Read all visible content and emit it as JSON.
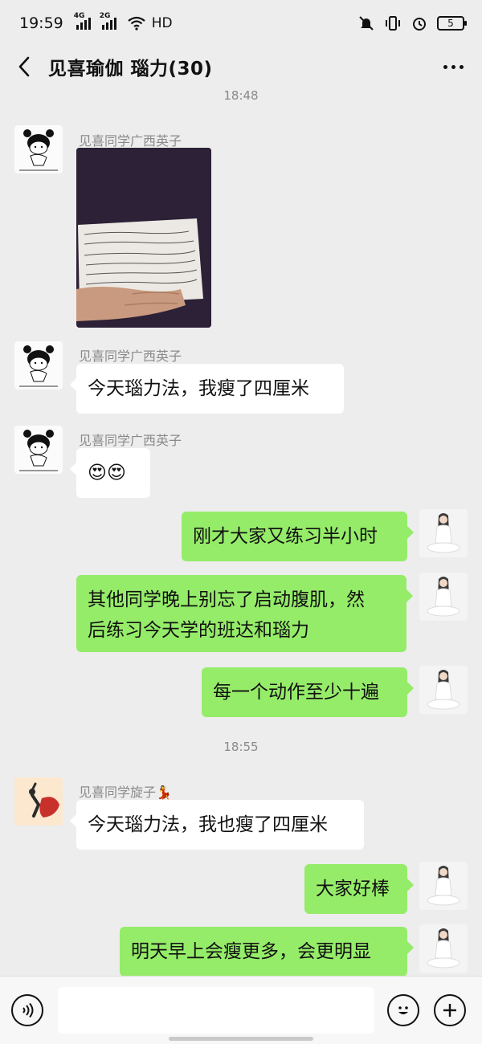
{
  "status_bar": {
    "time": "19:59",
    "network_1": "4G",
    "network_2": "2G",
    "wifi_label": "HD",
    "battery": "5"
  },
  "header": {
    "title": "见喜瑜伽 瑙力(30)"
  },
  "timestamps": [
    "18:48",
    "18:55"
  ],
  "messages": [
    {
      "sender": "见喜同学广西英子",
      "direction": "in",
      "type": "image"
    },
    {
      "sender": "见喜同学广西英子",
      "direction": "in",
      "text": "今天瑙力法，我瘦了四厘米"
    },
    {
      "sender": "见喜同学广西英子",
      "direction": "in",
      "text": "😍😍"
    },
    {
      "direction": "out",
      "text": "刚才大家又练习半小时"
    },
    {
      "direction": "out",
      "text_line1": "其他同学晚上别忘了启动腹肌，然",
      "text_line2": "后练习今天学的班达和瑙力"
    },
    {
      "direction": "out",
      "text": "每一个动作至少十遍"
    },
    {
      "sender": "见喜同学旋子💃",
      "direction": "in",
      "text": "今天瑙力法，我也瘦了四厘米"
    },
    {
      "direction": "out",
      "text": "大家好棒"
    },
    {
      "direction": "out",
      "text": "明天早上会瘦更多，会更明显"
    }
  ],
  "input_bar": {
    "voice_icon": "voice-icon",
    "emoji_icon": "emoji-icon",
    "plus_icon": "plus-icon"
  },
  "colors": {
    "background": "#ededed",
    "outgoing_bubble": "#95ec69",
    "incoming_bubble": "#ffffff"
  }
}
